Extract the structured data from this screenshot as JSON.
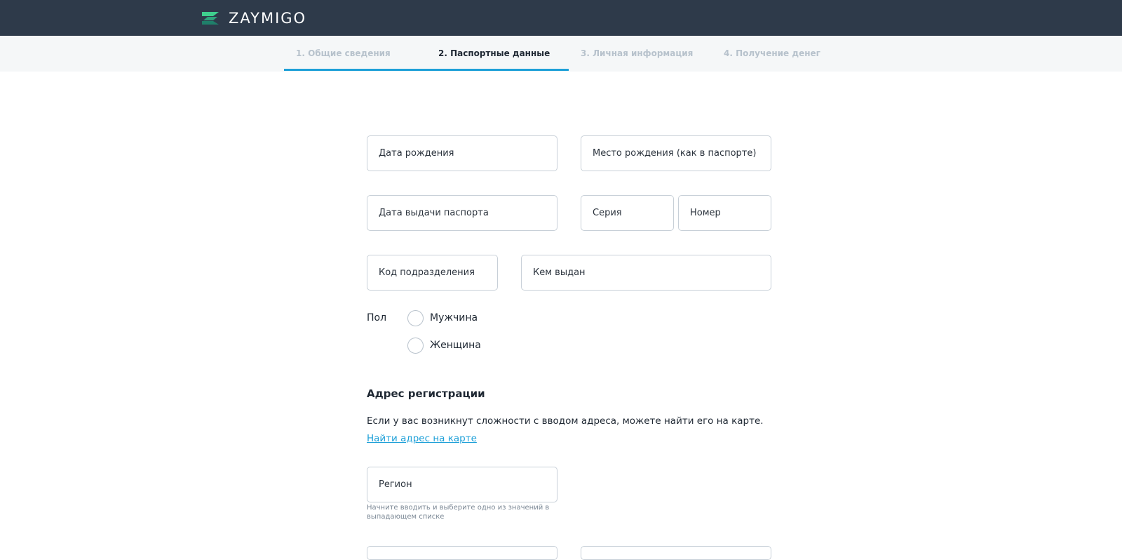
{
  "header": {
    "brand": "ZAYMIGO",
    "logo_colors": {
      "dark": "#1f7f6a",
      "light": "#3fcf8e",
      "mid": "#2fa37c"
    },
    "background": "#2e3a4a"
  },
  "steps": {
    "items": [
      {
        "label": "1. Общие сведения",
        "state": "done"
      },
      {
        "label": "2. Паспортные данные",
        "state": "active"
      },
      {
        "label": "3. Личная информация",
        "state": "pending"
      },
      {
        "label": "4. Получение денег",
        "state": "pending"
      }
    ],
    "progress_color": "#1ea0d8"
  },
  "form": {
    "birth_date": {
      "placeholder": "Дата рождения",
      "value": ""
    },
    "birth_place": {
      "placeholder": "Место рождения (как в паспорте)",
      "value": ""
    },
    "issue_date": {
      "placeholder": "Дата выдачи паспорта",
      "value": ""
    },
    "series": {
      "placeholder": "Серия",
      "value": ""
    },
    "number": {
      "placeholder": "Номер",
      "value": ""
    },
    "division_code": {
      "placeholder": "Код подразделения",
      "value": ""
    },
    "issued_by": {
      "placeholder": "Кем выдан",
      "value": ""
    },
    "gender": {
      "label": "Пол",
      "options": [
        "Мужчина",
        "Женщина"
      ],
      "selected": ""
    }
  },
  "address": {
    "title": "Адрес регистрации",
    "hint": "Если у вас возникнут сложности с вводом адреса, можете найти его на карте.",
    "map_link": "Найти адрес на карте",
    "region": {
      "placeholder": "Регион",
      "value": ""
    },
    "region_helper": "Начните вводить и выберите одно из значений в выпадающем списке"
  },
  "icons": {
    "logo": "zaymigo-logo-icon",
    "radio": "radio-empty-icon"
  }
}
